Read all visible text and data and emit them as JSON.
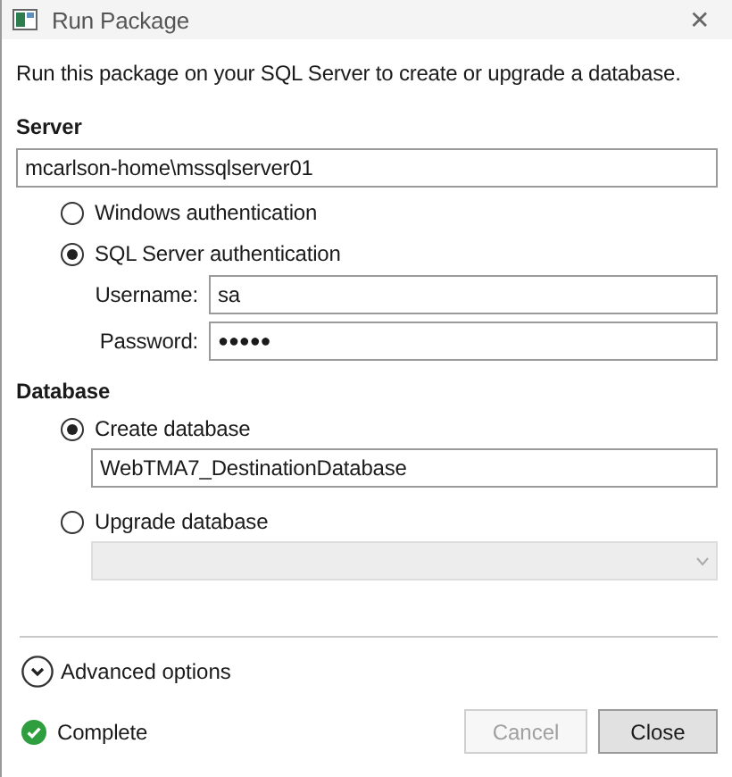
{
  "window": {
    "title": "Run Package",
    "close": "✕"
  },
  "description": "Run this package on your SQL Server to create or upgrade a database.",
  "server": {
    "heading": "Server",
    "value": "mcarlson-home\\mssqlserver01",
    "auth": [
      {
        "label": "Windows authentication",
        "selected": false
      },
      {
        "label": "SQL Server authentication",
        "selected": true
      }
    ],
    "username": {
      "label": "Username:",
      "value": "sa"
    },
    "password": {
      "label": "Password:",
      "value": "●●●●●"
    }
  },
  "database": {
    "heading": "Database",
    "options": [
      {
        "label": "Create database",
        "selected": true,
        "kind": "text",
        "value": "WebTMA7_DestinationDatabase",
        "disabled": false
      },
      {
        "label": "Upgrade database",
        "selected": false,
        "kind": "dropdown",
        "disabled": true
      }
    ]
  },
  "advanced": {
    "label": "Advanced options",
    "expanded": false
  },
  "status": {
    "label": "Complete",
    "ok": true
  },
  "buttons": [
    {
      "label": "Cancel",
      "disabled": true
    },
    {
      "label": "Close",
      "disabled": false
    }
  ]
}
